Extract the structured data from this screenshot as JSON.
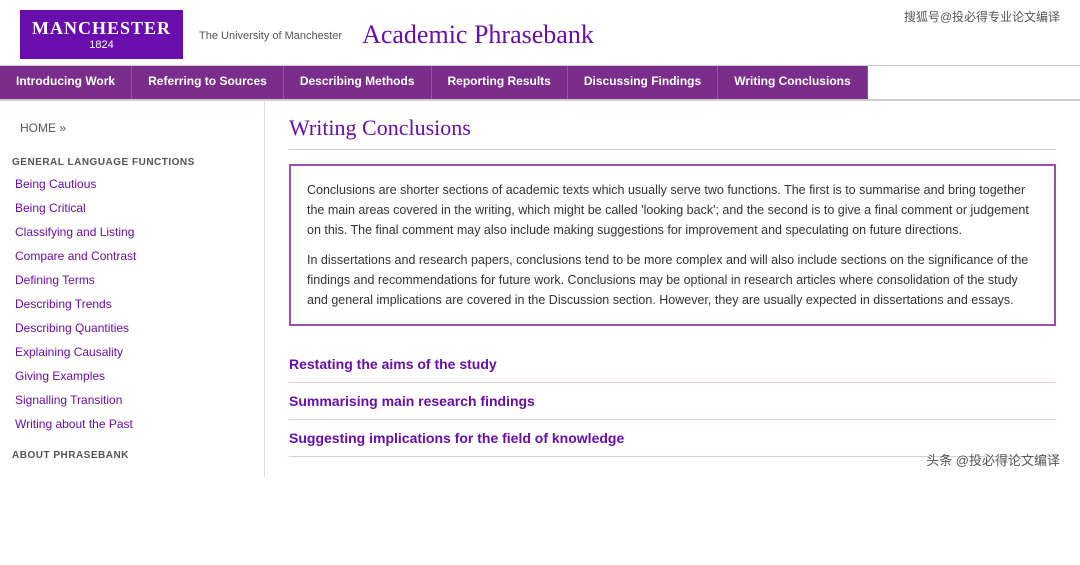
{
  "watermark": {
    "top": "搜狐号@投必得专业论文编译",
    "bottom": "头条 @投必得论文编译"
  },
  "header": {
    "logo_name": "MANCHESTER",
    "logo_year": "1824",
    "logo_sub": "The University of Manchester",
    "site_title": "Academic Phrasebank"
  },
  "navbar": {
    "items": [
      {
        "label": "Introducing Work",
        "active": false
      },
      {
        "label": "Referring to Sources",
        "active": false
      },
      {
        "label": "Describing Methods",
        "active": false
      },
      {
        "label": "Reporting Results",
        "active": false
      },
      {
        "label": "Discussing Findings",
        "active": false
      },
      {
        "label": "Writing Conclusions",
        "active": true
      }
    ]
  },
  "breadcrumb": {
    "home": "HOME",
    "separator": "»"
  },
  "page_title": "Writing Conclusions",
  "info_box": {
    "para1": "Conclusions are shorter sections of academic texts which usually serve two functions. The first is to summarise and bring together the main areas covered in the writing, which might be called 'looking back'; and the second is to give a final comment or judgement on this. The final comment may also include making suggestions for improvement and speculating on future directions.",
    "para2": "In dissertations and research papers, conclusions tend to be more complex and will also include sections on the significance of the findings and recommendations for future work. Conclusions may be optional in research articles where consolidation of the study and general implications are covered in the Discussion section. However, they are usually expected in dissertations and essays."
  },
  "sidebar": {
    "section_label": "GENERAL LANGUAGE FUNCTIONS",
    "links": [
      {
        "label": "Being Cautious"
      },
      {
        "label": "Being Critical"
      },
      {
        "label": "Classifying and Listing"
      },
      {
        "label": "Compare and Contrast"
      },
      {
        "label": "Defining Terms"
      },
      {
        "label": "Describing Trends"
      },
      {
        "label": "Describing Quantities"
      },
      {
        "label": "Explaining Causality"
      },
      {
        "label": "Giving Examples"
      },
      {
        "label": "Signalling Transition"
      },
      {
        "label": "Writing about the Past"
      }
    ],
    "about_label": "ABOUT PHRASEBANK"
  },
  "main_links": [
    {
      "label": "Restating the aims of the study"
    },
    {
      "label": "Summarising main research findings"
    },
    {
      "label": "Suggesting implications for the field of knowledge"
    }
  ]
}
